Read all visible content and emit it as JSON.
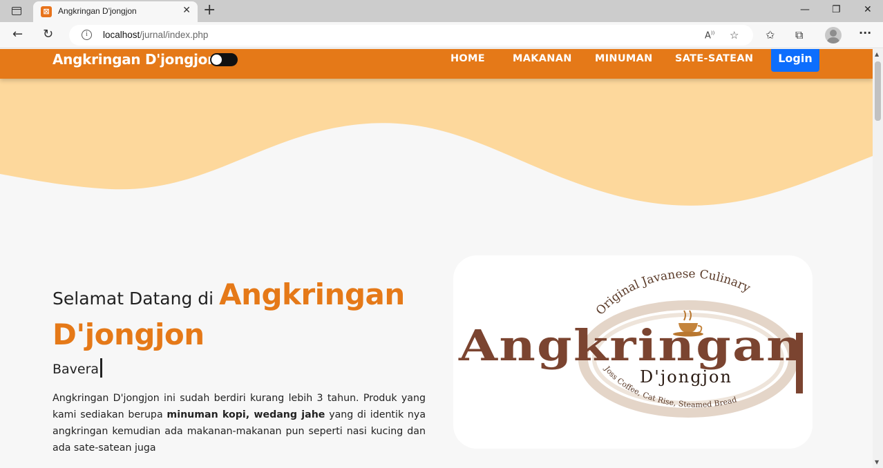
{
  "browser": {
    "tab_title": "Angkringan D'jongjon",
    "url_host": "localhost",
    "url_path": "/jurnal/index.php"
  },
  "navbar": {
    "brand": "Angkringan D'jongjon",
    "links": [
      "HOME",
      "MAKANAN",
      "MINUMAN",
      "SATE-SATEAN"
    ],
    "login": "Login",
    "colors": {
      "primary": "#e57918",
      "login": "#0d6efd",
      "wave": "#fdd89c"
    }
  },
  "hero": {
    "welcome_prefix": "Selamat Datang di",
    "brand_line1": "Angkringan",
    "brand_line2": "D'jongjon",
    "typed_text": "Bavera",
    "desc_part1": "Angkringan D'jongjon ini sudah berdiri kurang lebih 3 tahun. Produk yang kami sediakan berupa ",
    "desc_bold": "minuman kopi, wedang jahe",
    "desc_part2": " yang di identik nya angkringan kemudian ada makanan-makanan pun seperti nasi kucing dan ada sate-satean juga"
  },
  "logo": {
    "arc_text": "Original Javanese Culinary",
    "main_text": "Angkringan",
    "sub_text": "D'jongjon",
    "bottom_arc_text": "Joss Coffee, Cat Rise, Steamed Bread"
  }
}
